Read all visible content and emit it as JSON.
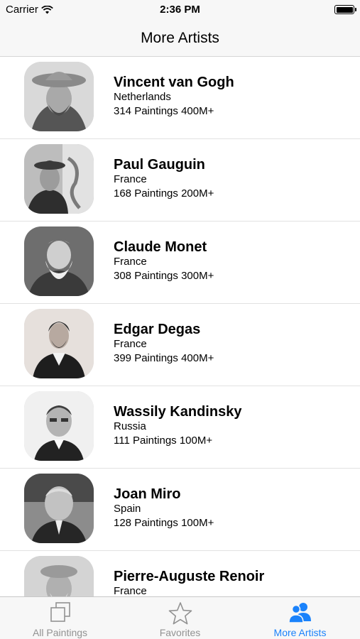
{
  "status_bar": {
    "carrier": "Carrier",
    "time": "2:36 PM"
  },
  "nav": {
    "title": "More Artists"
  },
  "artists": [
    {
      "name": "Vincent van Gogh",
      "country": "Netherlands",
      "stats": "314 Paintings 400M+"
    },
    {
      "name": "Paul Gauguin",
      "country": "France",
      "stats": "168 Paintings 200M+"
    },
    {
      "name": "Claude Monet",
      "country": "France",
      "stats": "308 Paintings 300M+"
    },
    {
      "name": "Edgar Degas",
      "country": "France",
      "stats": "399 Paintings 400M+"
    },
    {
      "name": "Wassily Kandinsky",
      "country": "Russia",
      "stats": "111 Paintings 100M+"
    },
    {
      "name": "Joan Miro",
      "country": "Spain",
      "stats": "128 Paintings 100M+"
    },
    {
      "name": "Pierre-Auguste Renoir",
      "country": "France",
      "stats": ""
    }
  ],
  "tabs": [
    {
      "label": "All Paintings",
      "icon": "squares-icon",
      "active": false
    },
    {
      "label": "Favorites",
      "icon": "star-icon",
      "active": false
    },
    {
      "label": "More Artists",
      "icon": "people-icon",
      "active": true
    }
  ],
  "colors": {
    "accent": "#1a82fb",
    "inactive": "#929292",
    "bar_bg": "#f7f7f7"
  }
}
